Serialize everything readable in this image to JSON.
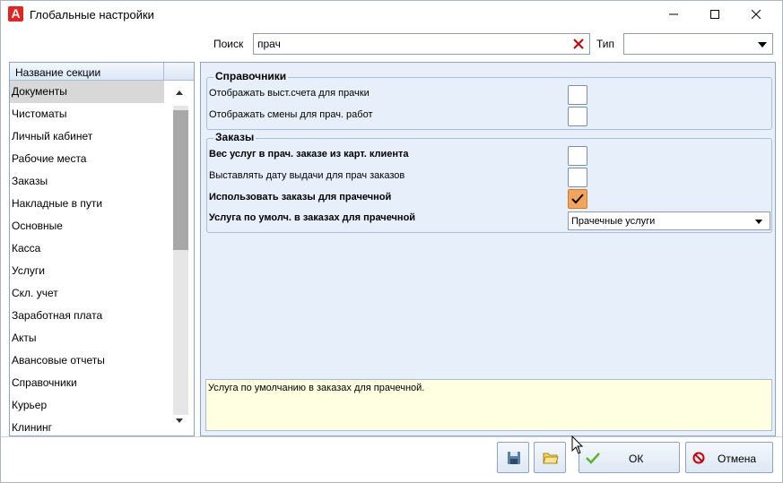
{
  "window": {
    "title": "Глобальные настройки",
    "app_icon_letter": "A"
  },
  "search": {
    "label": "Поиск",
    "value": "прач",
    "type_label": "Тип",
    "type_value": ""
  },
  "sections": {
    "column_header": "Название секции",
    "selected": "Документы",
    "items": [
      "Документы",
      "Чистоматы",
      "Личный кабинет",
      "Рабочие места",
      "Заказы",
      "Накладные в пути",
      "Основные",
      "Касса",
      "Услуги",
      "Скл. учет",
      "Заработная плата",
      "Акты",
      "Авансовые отчеты",
      "Справочники",
      "Курьер",
      "Клининг"
    ]
  },
  "groups": {
    "references": {
      "title": "Справочники",
      "settings": [
        {
          "label": "Отображать выст.счета для прачки",
          "bold": false,
          "checked": false
        },
        {
          "label": "Отображать смены для прач. работ",
          "bold": false,
          "checked": false
        }
      ]
    },
    "orders": {
      "title": "Заказы",
      "settings": [
        {
          "label": "Вес услуг в прач. заказе из карт. клиента",
          "bold": true,
          "checked": false
        },
        {
          "label": "Выставлять дату выдачи для прач заказов",
          "bold": false,
          "checked": false
        },
        {
          "label": "Использовать заказы для прачечной",
          "bold": true,
          "checked": true
        },
        {
          "label": "Услуга по умолч. в заказах для прачечной",
          "bold": true,
          "select_value": "Прачечные услуги"
        }
      ]
    }
  },
  "description": "Услуга по умолчанию в заказах для прачечной.",
  "buttons": {
    "ok": "ОК",
    "cancel": "Отмена"
  },
  "colors": {
    "panel_bg": "#e7f0fa",
    "checked_bg": "#f6a45a",
    "description_bg": "#ffffe1",
    "selected_row": "#d8d8d8",
    "brand_red": "#e52421"
  }
}
